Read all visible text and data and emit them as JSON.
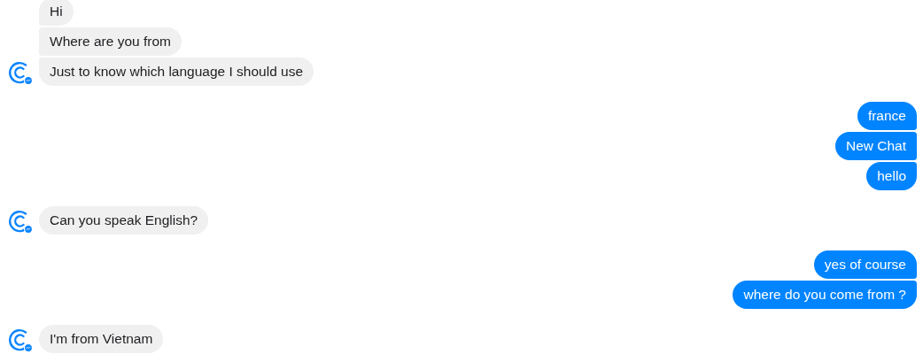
{
  "groups": [
    {
      "kind": "incoming",
      "messages": [
        "Hi",
        "Where are you from",
        "Just to know which language I should use"
      ]
    },
    {
      "kind": "outgoing",
      "messages": [
        "france",
        "New Chat",
        "hello"
      ]
    },
    {
      "kind": "incoming",
      "messages": [
        "Can you speak English?"
      ]
    },
    {
      "kind": "outgoing",
      "messages": [
        "yes of course",
        "where do you come from ?"
      ]
    },
    {
      "kind": "incoming",
      "messages": [
        "I'm from Vietnam"
      ]
    }
  ]
}
